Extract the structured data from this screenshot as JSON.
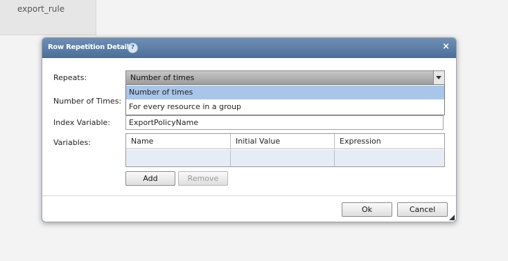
{
  "background": {
    "tab_label": "export_rule"
  },
  "dialog": {
    "title": "Row Repetition Details",
    "help_icon": "?",
    "close_icon": "×"
  },
  "form": {
    "repeats_label": "Repeats:",
    "repeats_value": "Number of times",
    "repeats_options": [
      "Number of times",
      "For every resource in a group"
    ],
    "number_of_times_label": "Number of Times:",
    "index_variable_label": "Index Variable:",
    "index_variable_value": "ExportPolicyName",
    "variables_label": "Variables:"
  },
  "variables_table": {
    "columns": [
      "Name",
      "Initial Value",
      "Expression"
    ]
  },
  "buttons": {
    "add": "Add",
    "remove": "Remove",
    "ok": "Ok",
    "cancel": "Cancel"
  },
  "colors": {
    "titlebar": "#5b7ca6",
    "selected_option": "#a9c5ea",
    "grid_cell": "#e6ecf5"
  }
}
